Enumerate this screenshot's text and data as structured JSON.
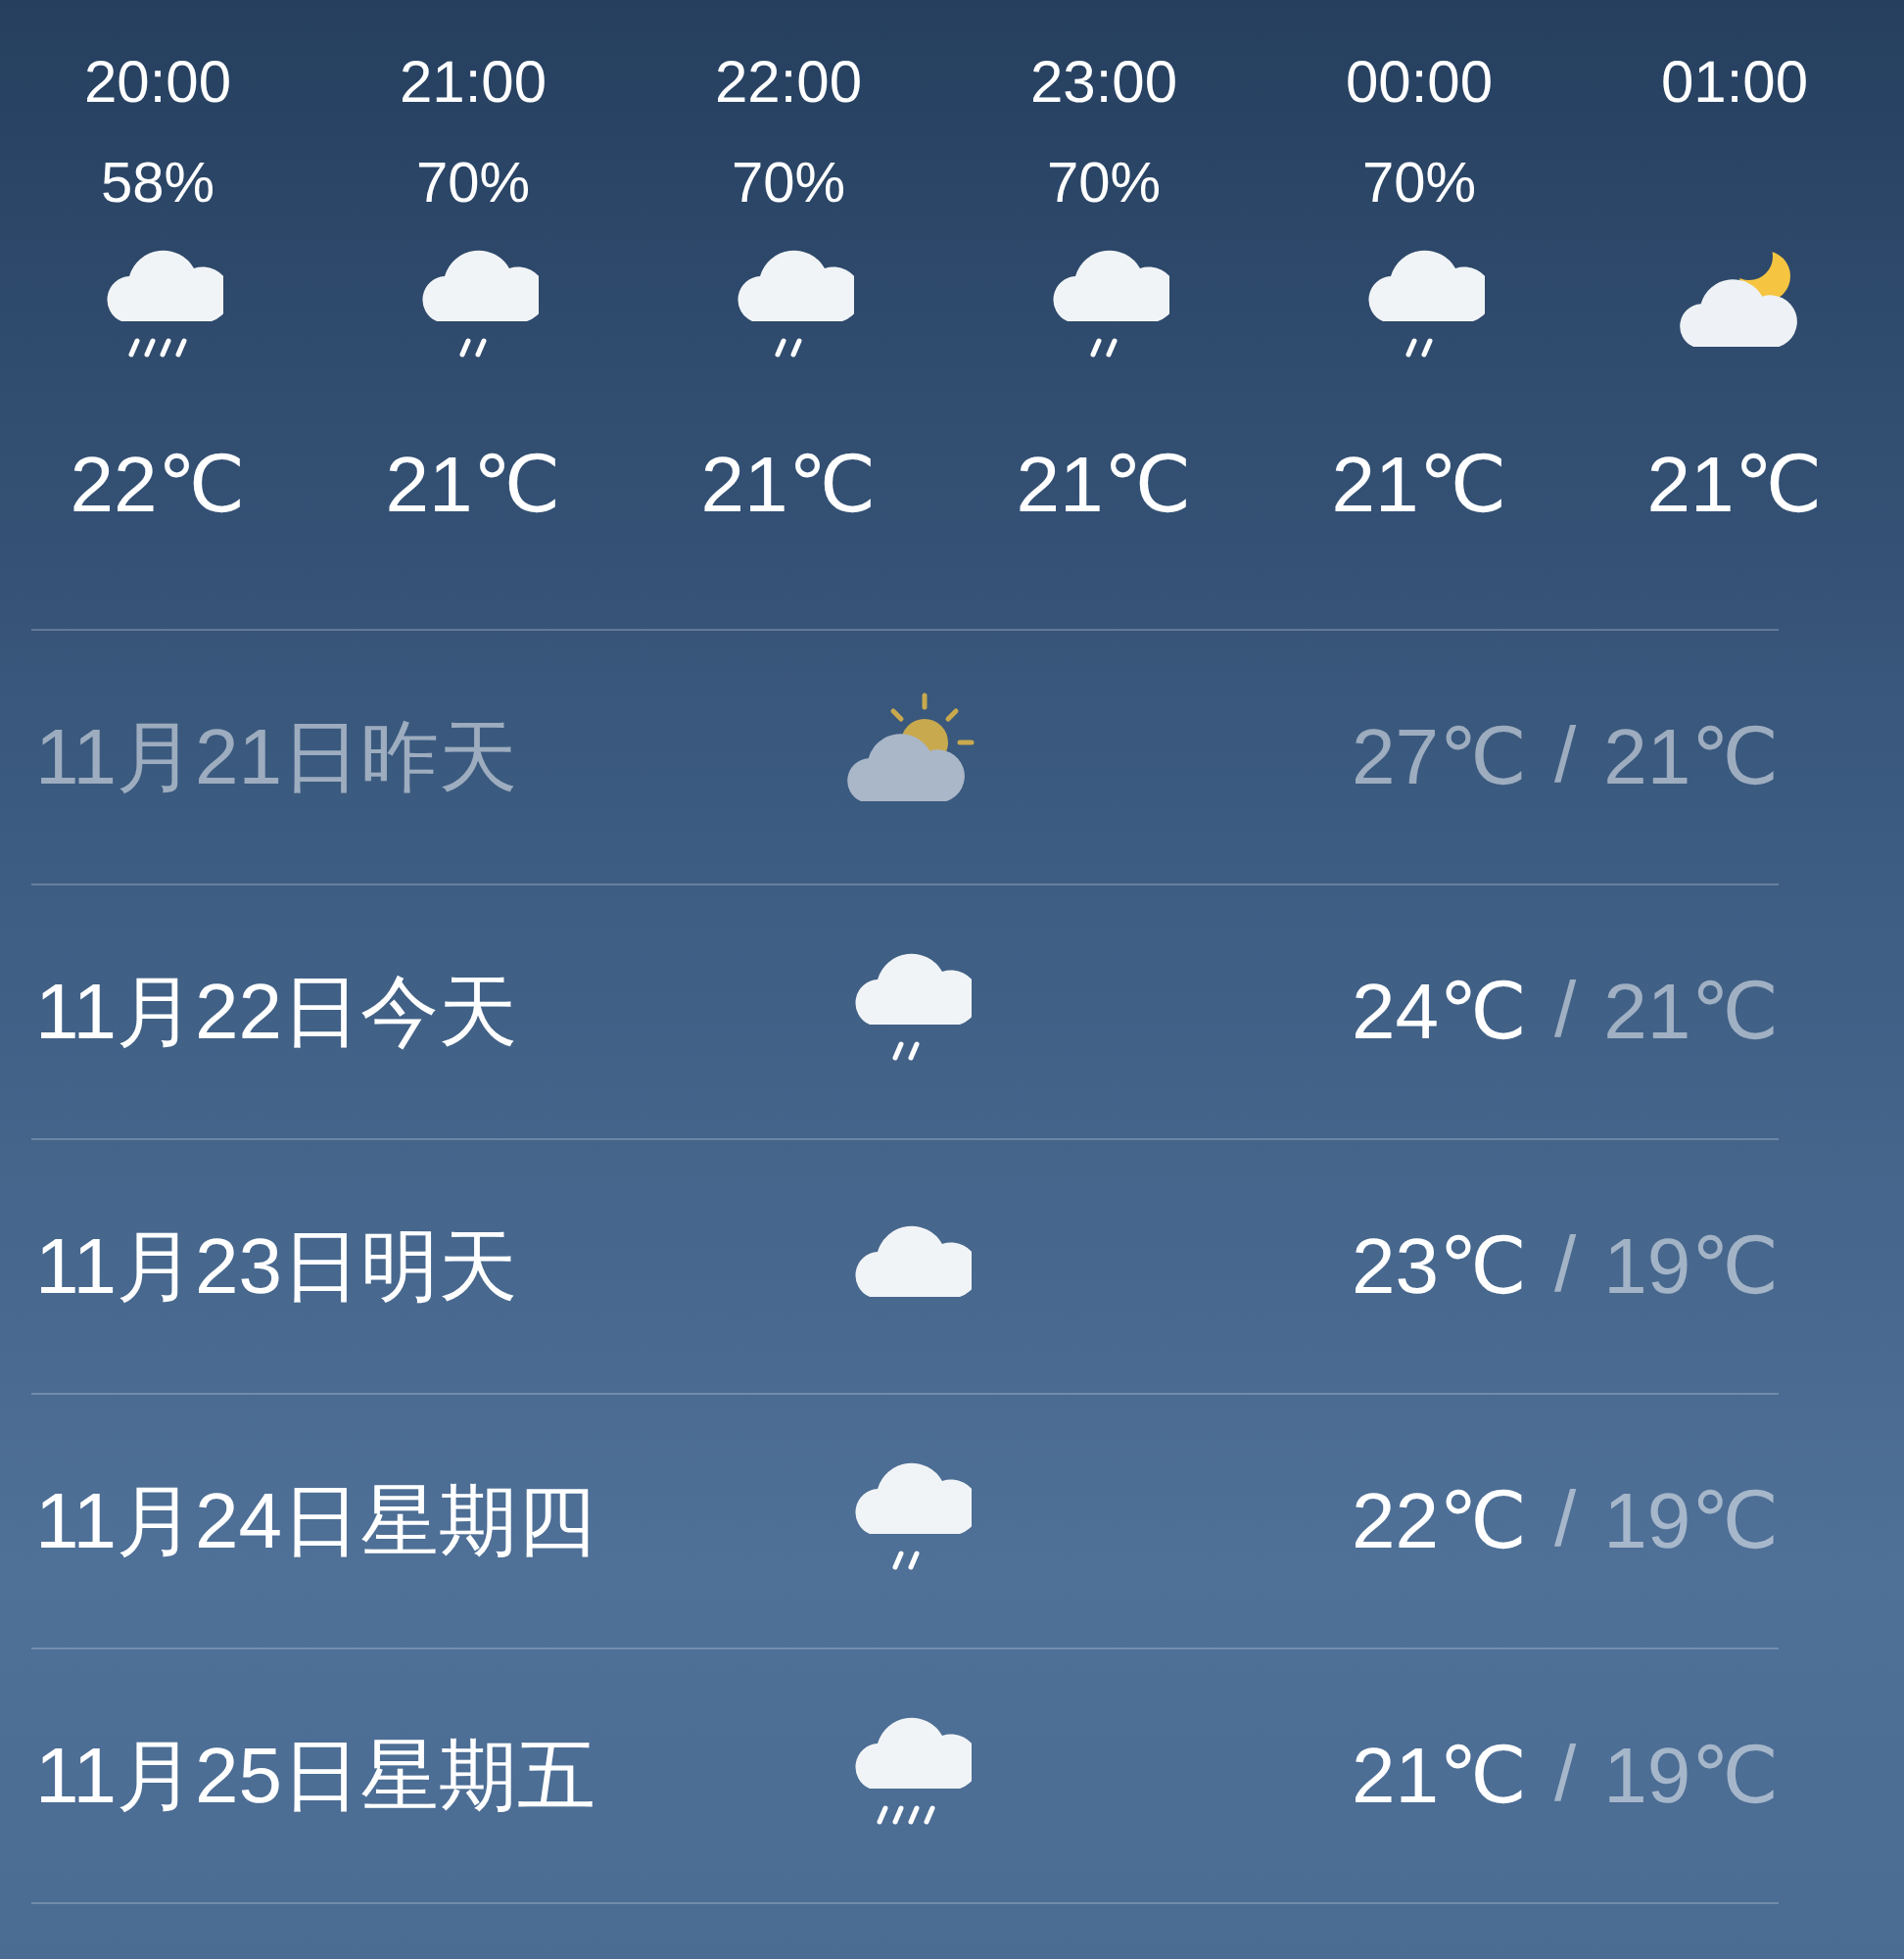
{
  "hourly": [
    {
      "time": "20:00",
      "humidity": "58%",
      "kind": "showers",
      "temp": "22℃"
    },
    {
      "time": "21:00",
      "humidity": "70%",
      "kind": "rain",
      "temp": "21℃"
    },
    {
      "time": "22:00",
      "humidity": "70%",
      "kind": "rain",
      "temp": "21℃"
    },
    {
      "time": "23:00",
      "humidity": "70%",
      "kind": "rain",
      "temp": "21℃"
    },
    {
      "time": "00:00",
      "humidity": "70%",
      "kind": "rain",
      "temp": "21℃"
    },
    {
      "time": "01:00",
      "kind": "night",
      "temp": "21℃"
    }
  ],
  "daily": [
    {
      "date": "11月21日昨天",
      "past": true,
      "kind": "partly",
      "high": "27℃",
      "separator": "/",
      "low": "21℃"
    },
    {
      "date": "11月22日今天",
      "past": false,
      "kind": "rain",
      "high": "24℃",
      "separator": "/",
      "low": "21℃"
    },
    {
      "date": "11月23日明天",
      "past": false,
      "kind": "cloudy",
      "high": "23℃",
      "separator": "/",
      "low": "19℃"
    },
    {
      "date": "11月24日星期四",
      "past": false,
      "kind": "rain",
      "high": "22℃",
      "separator": "/",
      "low": "19℃"
    },
    {
      "date": "11月25日星期五",
      "past": false,
      "kind": "showers",
      "high": "21℃",
      "separator": "/",
      "low": "19℃"
    }
  ]
}
